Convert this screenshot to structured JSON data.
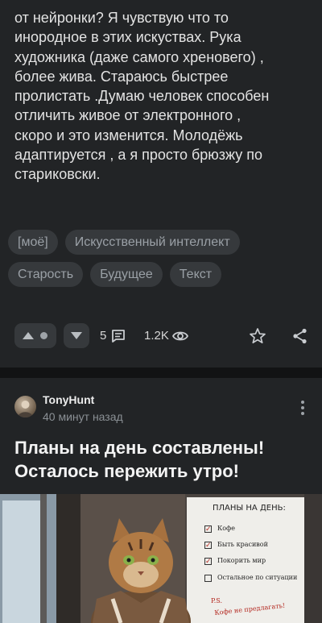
{
  "post1": {
    "text": [
      "от нейронки? Я чувствую что то",
      "инородное в этих искуствах. Рука",
      "художника (даже самого хреновего) ,",
      "более жива. Стараюсь быстрее",
      "пролистать .Думаю человек способен",
      "отличить живое от электронного ,",
      "скоро и это изменится. Молодёжь",
      "адаптируется , а я просто брюзжу по",
      "стариковски."
    ],
    "tags": [
      "[моё]",
      "Искусственный интеллект",
      "Старость",
      "Будущее",
      "Текст"
    ],
    "comments_count": "5",
    "views_count": "1.2K"
  },
  "post2": {
    "author": "TonyHunt",
    "time": "40 минут назад",
    "title": "Планы на день составлены! Осталось пережить утро!",
    "image": {
      "board_title": "ПЛАНЫ НА ДЕНЬ:",
      "items": [
        "Кофе",
        "Быть красивой",
        "Покорить мир",
        "Остальное по ситуации"
      ],
      "ps": "P.S.",
      "ps_text": "Кофе не предлагать!"
    }
  },
  "colors": {
    "card_bg": "#222426",
    "page_bg": "#121314",
    "tag_bg": "#36393c",
    "tag_text": "#9aa0a6"
  }
}
